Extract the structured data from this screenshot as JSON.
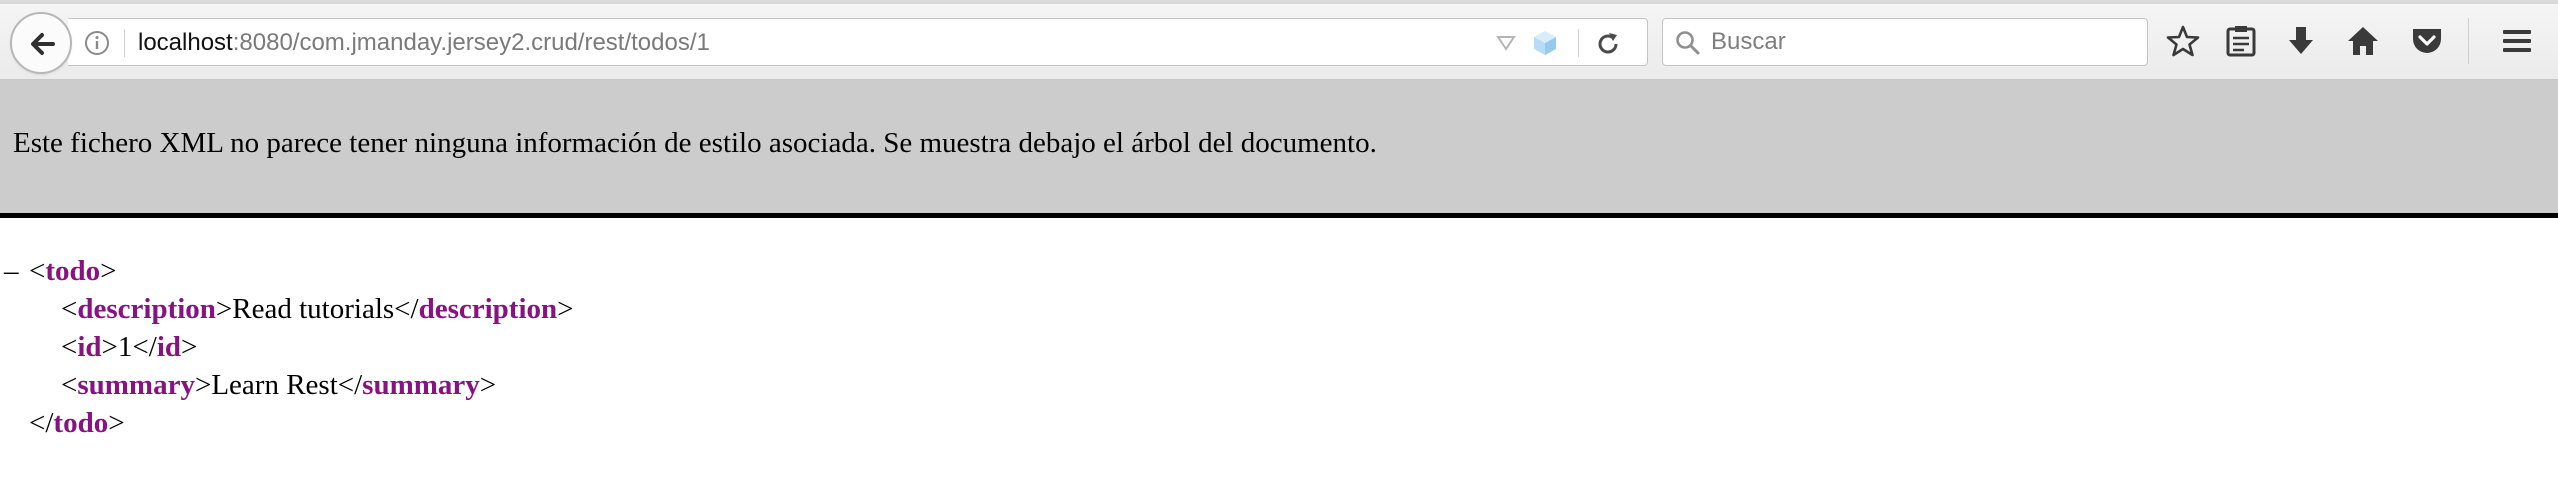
{
  "browser": {
    "url_host": "localhost",
    "url_rest": ":8080/com.jmanday.jersey2.crud/rest/todos/1",
    "search_placeholder": "Buscar"
  },
  "icons": {
    "back": "back-arrow-icon",
    "site_info": "info-icon",
    "url_dropmarker": "dropdown-triangle-icon",
    "extension": "cube-icon",
    "reload": "reload-icon",
    "search": "search-icon",
    "bookmark": "star-icon",
    "reading_list": "clipboard-icon",
    "downloads": "download-arrow-icon",
    "home": "home-icon",
    "pocket": "pocket-icon",
    "menu": "hamburger-menu-icon"
  },
  "banner": {
    "text": "Este fichero XML no parece tener ninguna información de estilo asociada. Se muestra debajo el árbol del documento."
  },
  "xml": {
    "collapse_marker": "–",
    "root_tag": "todo",
    "elements": [
      {
        "tag": "description",
        "value": "Read tutorials"
      },
      {
        "tag": "id",
        "value": "1"
      },
      {
        "tag": "summary",
        "value": "Learn Rest"
      }
    ]
  },
  "colors": {
    "banner_bg": "#cccccc",
    "tag_color": "#881280",
    "banner_rule": "#000000"
  }
}
